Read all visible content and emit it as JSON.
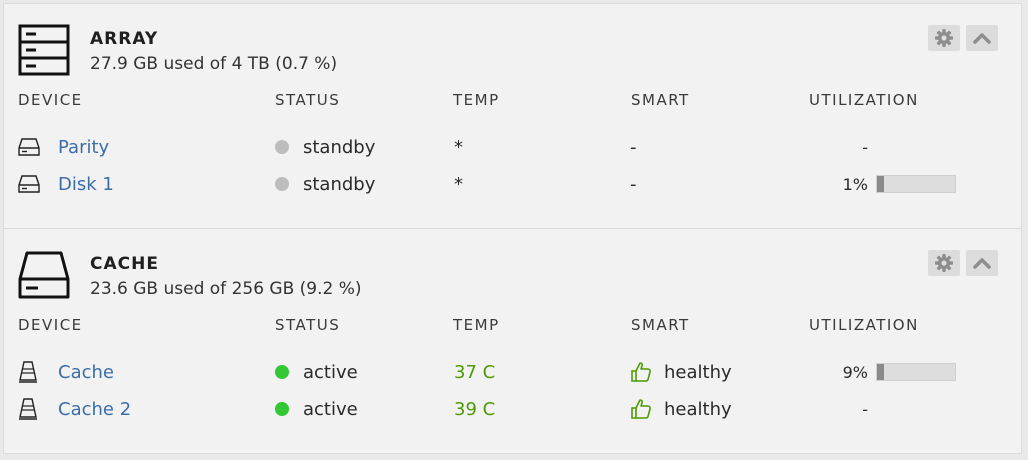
{
  "columns": [
    "DEVICE",
    "STATUS",
    "TEMP",
    "SMART",
    "UTILIZATION"
  ],
  "colors": {
    "link": "#3b6ea8",
    "standby_dot": "#bdbdbd",
    "active_dot": "#33c733",
    "temp_ok": "#4e9a06",
    "healthy": "#4e9a06"
  },
  "array": {
    "title": "ARRAY",
    "icon": "array-server-icon",
    "usage": "27.9 GB used of 4 TB (0.7 %)",
    "devices": [
      {
        "name": "Parity",
        "icon": "hdd-icon",
        "status": "standby",
        "temp": "*",
        "smart": "-",
        "util_text": "-",
        "util": null
      },
      {
        "name": "Disk 1",
        "icon": "hdd-icon",
        "status": "standby",
        "temp": "*",
        "smart": "-",
        "util_text": "1%",
        "util": 0.01
      }
    ]
  },
  "cache": {
    "title": "CACHE",
    "icon": "cache-drive-icon",
    "usage": "23.6 GB used of 256 GB (9.2 %)",
    "devices": [
      {
        "name": "Cache",
        "icon": "ssd-icon",
        "status": "active",
        "temp": "37 C",
        "smart": "healthy",
        "util_text": "9%",
        "util": 0.09
      },
      {
        "name": "Cache 2",
        "icon": "ssd-icon",
        "status": "active",
        "temp": "39 C",
        "smart": "healthy",
        "util_text": "-",
        "util": null
      }
    ]
  }
}
